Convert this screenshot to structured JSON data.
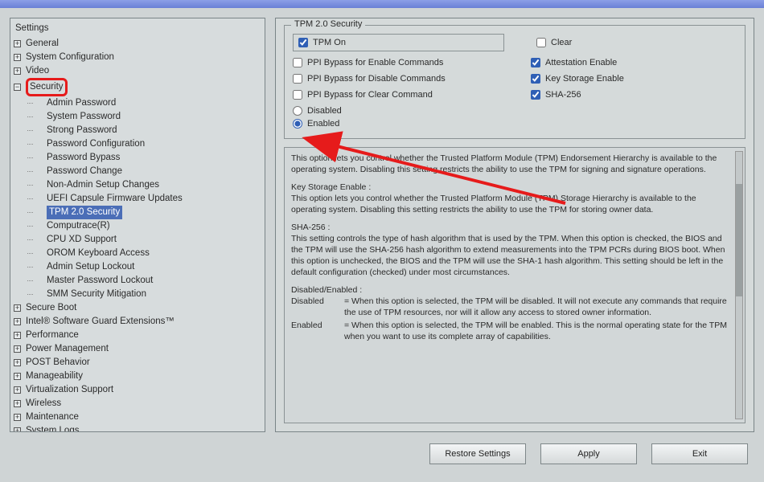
{
  "sidebar": {
    "title": "Settings",
    "items": [
      {
        "label": "General",
        "expandable": true
      },
      {
        "label": "System Configuration",
        "expandable": true
      },
      {
        "label": "Video",
        "expandable": true
      },
      {
        "label": "Security",
        "expandable": true,
        "highlighted": true,
        "expanded": true,
        "children": [
          {
            "label": "Admin Password"
          },
          {
            "label": "System Password"
          },
          {
            "label": "Strong Password"
          },
          {
            "label": "Password Configuration"
          },
          {
            "label": "Password Bypass"
          },
          {
            "label": "Password Change"
          },
          {
            "label": "Non-Admin Setup Changes"
          },
          {
            "label": "UEFI Capsule Firmware Updates"
          },
          {
            "label": "TPM 2.0 Security",
            "selected": true
          },
          {
            "label": "Computrace(R)"
          },
          {
            "label": "CPU XD Support"
          },
          {
            "label": "OROM Keyboard Access"
          },
          {
            "label": "Admin Setup Lockout"
          },
          {
            "label": "Master Password Lockout"
          },
          {
            "label": "SMM Security Mitigation"
          }
        ]
      },
      {
        "label": "Secure Boot",
        "expandable": true
      },
      {
        "label": "Intel® Software Guard Extensions™",
        "expandable": true
      },
      {
        "label": "Performance",
        "expandable": true
      },
      {
        "label": "Power Management",
        "expandable": true
      },
      {
        "label": "POST Behavior",
        "expandable": true
      },
      {
        "label": "Manageability",
        "expandable": true
      },
      {
        "label": "Virtualization Support",
        "expandable": true
      },
      {
        "label": "Wireless",
        "expandable": true
      },
      {
        "label": "Maintenance",
        "expandable": true
      },
      {
        "label": "System Logs",
        "expandable": true
      }
    ]
  },
  "panel": {
    "group_title": "TPM 2.0 Security",
    "checks": [
      [
        {
          "label": "TPM On",
          "checked": true,
          "boxed": true
        },
        {
          "label": "Clear",
          "checked": false
        }
      ],
      [
        {
          "label": "PPI Bypass for Enable Commands",
          "checked": false
        },
        {
          "label": "Attestation Enable",
          "checked": true
        }
      ],
      [
        {
          "label": "PPI Bypass for Disable Commands",
          "checked": false
        },
        {
          "label": "Key Storage Enable",
          "checked": true
        }
      ],
      [
        {
          "label": "PPI Bypass for Clear Command",
          "checked": false
        },
        {
          "label": "SHA-256",
          "checked": true
        }
      ]
    ],
    "radios": {
      "disabled": "Disabled",
      "enabled": "Enabled",
      "value": "enabled"
    }
  },
  "help": {
    "p1": "This option lets you control whether the Trusted Platform Module (TPM) Endorsement Hierarchy is available to the operating system.  Disabling this setting restricts the ability to use the TPM for signing and signature operations.",
    "h2": "Key Storage Enable :",
    "p2": "This option lets you control whether the Trusted Platform Module (TPM) Storage Hierarchy is available to the operating system.  Disabling this setting restricts the ability to use the TPM for storing owner data.",
    "h3": "SHA-256 :",
    "p3": "This setting controls the type of hash algorithm that is used by the TPM. When this option is checked, the BIOS and the TPM will use the SHA-256 hash algorithm to extend measurements into the TPM PCRs during BIOS boot. When this option is unchecked, the BIOS and the TPM will use the SHA-1 hash algorithm. This setting should be left in the default configuration (checked) under most circumstances.",
    "h4": "Disabled/Enabled :",
    "d_disabled_k": "Disabled",
    "d_disabled_v": "= When this option is selected, the TPM will be disabled. It will not execute any commands that require the use of TPM resources, nor will it allow any access to stored owner information.",
    "d_enabled_k": "Enabled",
    "d_enabled_v": "= When this option is selected, the TPM will be enabled. This is the normal operating state for the TPM when you want to use its complete array of capabilities."
  },
  "footer": {
    "restore": "Restore Settings",
    "apply": "Apply",
    "exit": "Exit"
  }
}
